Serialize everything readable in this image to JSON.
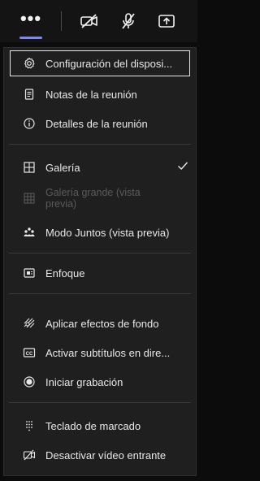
{
  "toolbar": {
    "more_icon": "more-dots-icon",
    "camera_icon": "camera-off-icon",
    "mic_icon": "mic-off-icon",
    "share_icon": "share-tray-icon",
    "more_dots": "•••"
  },
  "menu": {
    "items": [
      {
        "label": "Configuración del disposi...",
        "icon": "gear-icon"
      },
      {
        "label": "Notas de la reunión",
        "icon": "notes-icon"
      },
      {
        "label": "Detalles de la reunión",
        "icon": "info-icon"
      },
      {
        "label": "Galería",
        "icon": "gallery-icon",
        "checked": true
      },
      {
        "label": "Galería grande (vista previa)",
        "icon": "large-gallery-icon",
        "disabled": true
      },
      {
        "label": "Modo Juntos (vista previa)",
        "icon": "together-mode-icon"
      },
      {
        "label": "Enfoque",
        "icon": "focus-icon"
      },
      {
        "label": "Aplicar efectos de fondo",
        "icon": "background-effects-icon"
      },
      {
        "label": "Activar subtítulos en dire...",
        "icon": "captions-icon"
      },
      {
        "label": "Iniciar grabación",
        "icon": "record-icon"
      },
      {
        "label": "Teclado de marcado",
        "icon": "dialpad-icon"
      },
      {
        "label": "Desactivar vídeo entrante",
        "icon": "incoming-video-off-icon"
      }
    ]
  },
  "colors": {
    "accent": "#7f85f5",
    "background": "#1f1f1f",
    "text": "#e8e8e8",
    "disabled_text": "#5a5a5a"
  }
}
